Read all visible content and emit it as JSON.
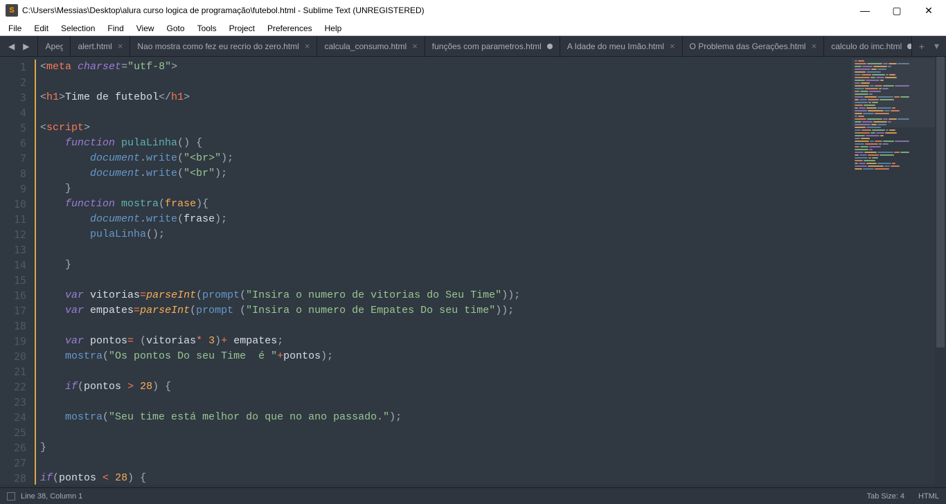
{
  "titlebar": {
    "app_icon_letter": "S",
    "title": "C:\\Users\\Messias\\Desktop\\alura curso logica de programação\\futebol.html - Sublime Text (UNREGISTERED)"
  },
  "window_controls": {
    "minimize": "—",
    "maximize": "▢",
    "close": "✕"
  },
  "menubar": [
    "File",
    "Edit",
    "Selection",
    "Find",
    "View",
    "Goto",
    "Tools",
    "Project",
    "Preferences",
    "Help"
  ],
  "nav": {
    "back": "◀",
    "forward": "▶"
  },
  "tabs": [
    {
      "label": "Apeg",
      "dirty": false,
      "close": false,
      "truncated": true
    },
    {
      "label": "alert.html",
      "dirty": false,
      "close": true
    },
    {
      "label": "Nao mostra como fez eu recrio do zero.html",
      "dirty": false,
      "close": true
    },
    {
      "label": "calcula_consumo.html",
      "dirty": false,
      "close": true
    },
    {
      "label": "funções com parametros.html",
      "dirty": true,
      "close": false
    },
    {
      "label": "A Idade do meu Imão.html",
      "dirty": false,
      "close": true
    },
    {
      "label": "O Problema das Gerações.html",
      "dirty": false,
      "close": true
    },
    {
      "label": "calculo do imc.html",
      "dirty": true,
      "close": false
    },
    {
      "label": "",
      "dirty": false,
      "close": true,
      "active": true
    }
  ],
  "tab_extras": {
    "new": "+",
    "menu": "▾"
  },
  "code_lines": [
    {
      "n": 1,
      "mod": true,
      "html": "<span class='t-punc'>&lt;</span><span class='t-tag'>meta</span> <span class='t-attr'>charset</span><span class='t-punc'>=</span><span class='t-str'>\"utf-8\"</span><span class='t-punc'>&gt;</span>"
    },
    {
      "n": 2,
      "mod": true,
      "html": ""
    },
    {
      "n": 3,
      "mod": true,
      "html": "<span class='t-punc'>&lt;</span><span class='t-tag'>h1</span><span class='t-punc'>&gt;</span>Time de futebol<span class='t-punc'>&lt;/</span><span class='t-tag'>h1</span><span class='t-punc'>&gt;</span>"
    },
    {
      "n": 4,
      "mod": true,
      "html": ""
    },
    {
      "n": 5,
      "mod": true,
      "html": "<span class='t-punc'>&lt;</span><span class='t-tag'>script</span><span class='t-punc'>&gt;</span>"
    },
    {
      "n": 6,
      "mod": true,
      "html": "    <span class='t-kw'>function</span> <span class='t-fn'>pulaLinha</span><span class='t-punc'>()</span> <span class='t-punc'>{</span>"
    },
    {
      "n": 7,
      "mod": true,
      "html": "        <span class='t-obj'>document</span><span class='t-punc'>.</span><span class='t-func'>write</span><span class='t-punc'>(</span><span class='t-str'>\"&lt;br&gt;\"</span><span class='t-punc'>);</span>"
    },
    {
      "n": 8,
      "mod": true,
      "html": "        <span class='t-obj'>document</span><span class='t-punc'>.</span><span class='t-func'>write</span><span class='t-punc'>(</span><span class='t-str'>\"&lt;br\"</span><span class='t-punc'>);</span>"
    },
    {
      "n": 9,
      "mod": true,
      "html": "    <span class='t-punc'>}</span>"
    },
    {
      "n": 10,
      "mod": true,
      "html": "    <span class='t-kw'>function</span> <span class='t-fn'>mostra</span><span class='t-punc'>(</span><span class='t-param'>frase</span><span class='t-punc'>){</span>"
    },
    {
      "n": 11,
      "mod": true,
      "html": "        <span class='t-obj'>document</span><span class='t-punc'>.</span><span class='t-func'>write</span><span class='t-punc'>(</span>frase<span class='t-punc'>);</span>"
    },
    {
      "n": 12,
      "mod": true,
      "html": "        <span class='t-func'>pulaLinha</span><span class='t-punc'>();</span>"
    },
    {
      "n": 13,
      "mod": true,
      "html": ""
    },
    {
      "n": 14,
      "mod": true,
      "html": "    <span class='t-punc'>}</span>"
    },
    {
      "n": 15,
      "mod": true,
      "html": ""
    },
    {
      "n": 16,
      "mod": true,
      "html": "    <span class='t-kw'>var</span> vitorias<span class='t-op'>=</span><span class='t-var'>parseInt</span><span class='t-punc'>(</span><span class='t-func'>prompt</span><span class='t-punc'>(</span><span class='t-str'>\"Insira o numero de vitorias do Seu Time\"</span><span class='t-punc'>));</span>"
    },
    {
      "n": 17,
      "mod": true,
      "html": "    <span class='t-kw'>var</span> empates<span class='t-op'>=</span><span class='t-var'>parseInt</span><span class='t-punc'>(</span><span class='t-func'>prompt</span> <span class='t-punc'>(</span><span class='t-str'>\"Insira o numero de Empates Do seu time\"</span><span class='t-punc'>));</span>"
    },
    {
      "n": 18,
      "mod": true,
      "html": ""
    },
    {
      "n": 19,
      "mod": true,
      "html": "    <span class='t-kw'>var</span> pontos<span class='t-op'>=</span> <span class='t-punc'>(</span>vitorias<span class='t-op'>*</span> <span class='t-num'>3</span><span class='t-punc'>)</span><span class='t-op'>+</span> empates<span class='t-punc'>;</span>"
    },
    {
      "n": 20,
      "mod": true,
      "html": "    <span class='t-func'>mostra</span><span class='t-punc'>(</span><span class='t-str'>\"Os pontos Do seu Time  é \"</span><span class='t-op'>+</span>pontos<span class='t-punc'>);</span>"
    },
    {
      "n": 21,
      "mod": true,
      "html": ""
    },
    {
      "n": 22,
      "mod": true,
      "html": "    <span class='t-kw'>if</span><span class='t-punc'>(</span>pontos <span class='t-op'>&gt;</span> <span class='t-num'>28</span><span class='t-punc'>)</span> <span class='t-punc'>{</span>"
    },
    {
      "n": 23,
      "mod": true,
      "html": ""
    },
    {
      "n": 24,
      "mod": true,
      "html": "    <span class='t-func'>mostra</span><span class='t-punc'>(</span><span class='t-str'>\"Seu time está melhor do que no ano passado.\"</span><span class='t-punc'>);</span>"
    },
    {
      "n": 25,
      "mod": true,
      "html": ""
    },
    {
      "n": 26,
      "mod": true,
      "html": "<span class='t-punc'>}</span>"
    },
    {
      "n": 27,
      "mod": true,
      "html": ""
    },
    {
      "n": 28,
      "mod": true,
      "html": "<span class='t-kw'>if</span><span class='t-punc'>(</span>pontos <span class='t-op'>&lt;</span> <span class='t-num'>28</span><span class='t-punc'>)</span> <span class='t-punc'>{</span>"
    }
  ],
  "statusbar": {
    "cursor": "Line 38, Column 1",
    "tab_size": "Tab Size: 4",
    "syntax": "HTML"
  }
}
